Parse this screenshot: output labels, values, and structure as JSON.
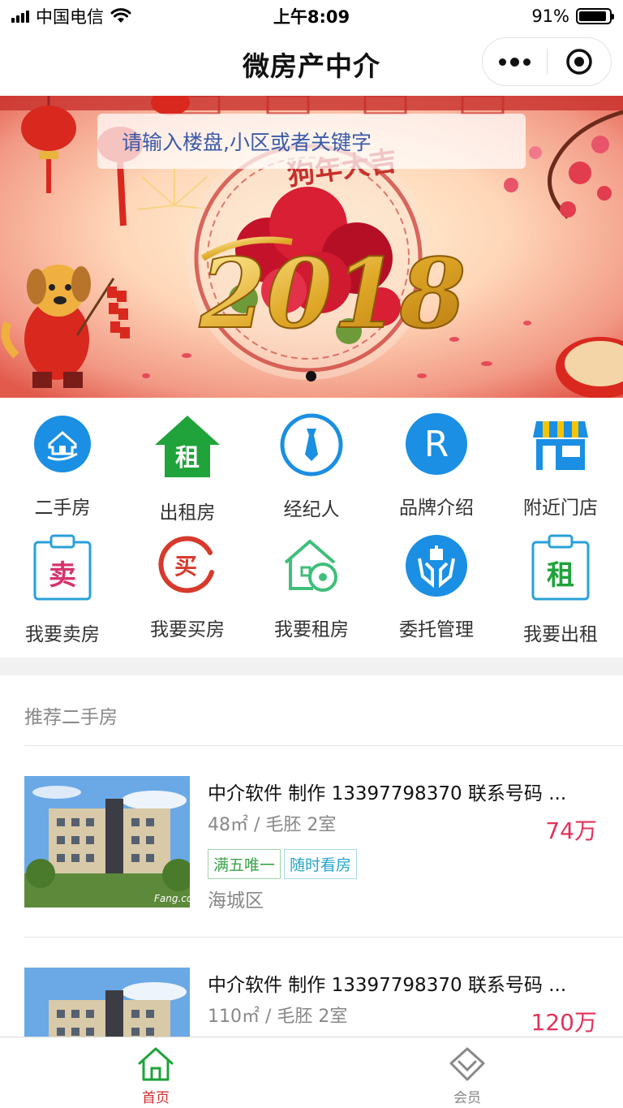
{
  "status_bar": {
    "carrier": "中国电信",
    "time": "上午8:09",
    "battery_percent": "91%",
    "battery_level": 0.91
  },
  "nav": {
    "title": "微房产中介"
  },
  "banner": {
    "search_placeholder": "请输入楼盘,小区或者关键字",
    "greeting_text": "狗年大吉",
    "year_text": "2018"
  },
  "menu": {
    "items": [
      {
        "label": "二手房",
        "icon": "house-hand-icon",
        "color": "#1a8fe3"
      },
      {
        "label": "出租房",
        "icon": "rent-house-icon",
        "color": "#1fa33a"
      },
      {
        "label": "经纪人",
        "icon": "tie-icon",
        "color": "#1a8fe3"
      },
      {
        "label": "品牌介绍",
        "icon": "brand-r-icon",
        "color": "#1a8fe3"
      },
      {
        "label": "附近门店",
        "icon": "store-icon",
        "color": "#1a8fe3"
      },
      {
        "label": "我要卖房",
        "icon": "sell-clipboard-icon",
        "color": "#d6336c"
      },
      {
        "label": "我要买房",
        "icon": "buy-circle-icon",
        "color": "#d63a2c"
      },
      {
        "label": "我要租房",
        "icon": "house-key-icon",
        "color": "#3fbf7a"
      },
      {
        "label": "委托管理",
        "icon": "hands-gift-icon",
        "color": "#1a8fe3"
      },
      {
        "label": "我要出租",
        "icon": "rent-clipboard-icon",
        "color": "#1fa33a"
      }
    ],
    "glyph_sell": "卖",
    "glyph_buy": "买",
    "glyph_rent": "租"
  },
  "recommend": {
    "title": "推荐二手房",
    "houses": [
      {
        "title": "中介软件 制作 13397798370 联系号码 ...",
        "spec": "48㎡ / 毛胚 2室",
        "price": "74万",
        "tags": [
          "满五唯一",
          "随时看房"
        ],
        "district": "海城区",
        "watermark": "Fang.com"
      },
      {
        "title": "中介软件 制作 13397798370 联系号码 ...",
        "spec": "110㎡ / 毛胚 2室",
        "price": "120万"
      }
    ]
  },
  "tab_bar": {
    "tabs": [
      {
        "label": "首页",
        "active": true
      },
      {
        "label": "会员",
        "active": false
      }
    ],
    "active_color": "#d12b2b",
    "active_icon_color": "#1fa33a"
  }
}
